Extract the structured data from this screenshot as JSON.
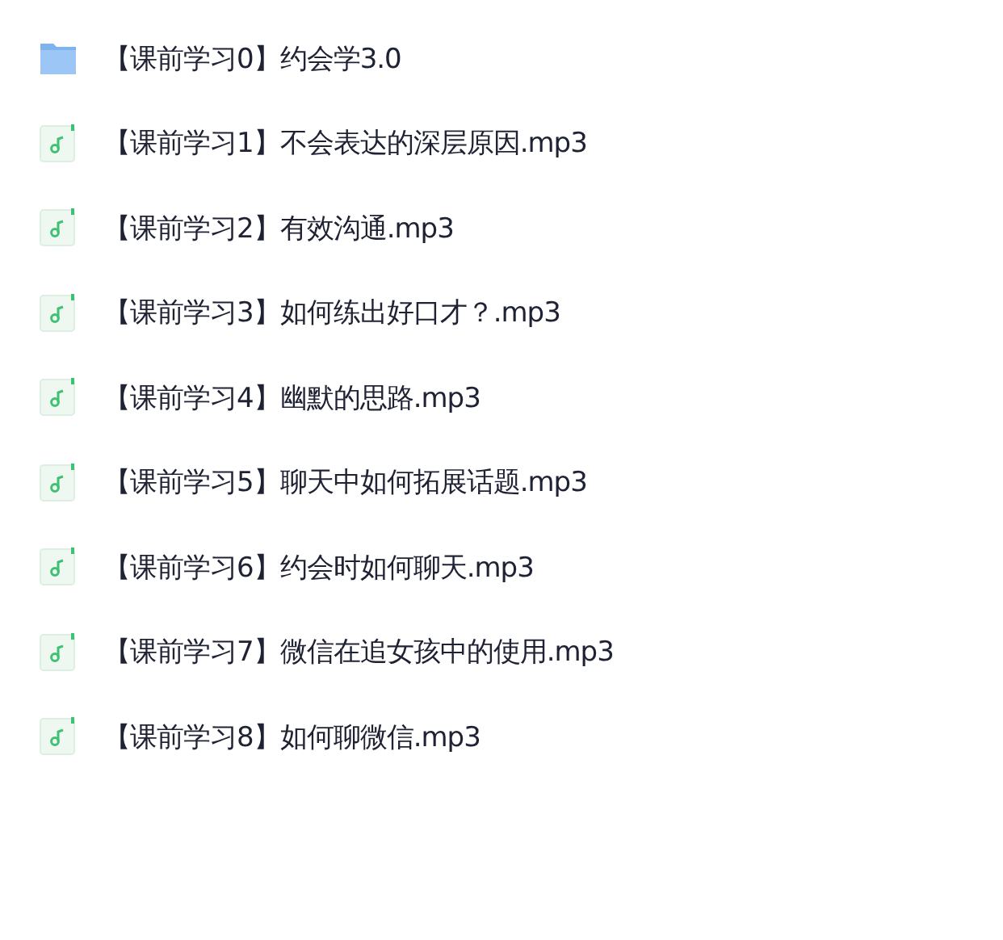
{
  "files": [
    {
      "kind": "folder",
      "name": "【课前学习0】约会学3.0"
    },
    {
      "kind": "audio",
      "name": "【课前学习1】不会表达的深层原因.mp3"
    },
    {
      "kind": "audio",
      "name": "【课前学习2】有效沟通.mp3"
    },
    {
      "kind": "audio",
      "name": "【课前学习3】如何练出好口才？.mp3"
    },
    {
      "kind": "audio",
      "name": "【课前学习4】幽默的思路.mp3"
    },
    {
      "kind": "audio",
      "name": "【课前学习5】聊天中如何拓展话题.mp3"
    },
    {
      "kind": "audio",
      "name": "【课前学习6】约会时如何聊天.mp3"
    },
    {
      "kind": "audio",
      "name": "【课前学习7】微信在追女孩中的使用.mp3"
    },
    {
      "kind": "audio",
      "name": "【课前学习8】如何聊微信.mp3"
    }
  ]
}
